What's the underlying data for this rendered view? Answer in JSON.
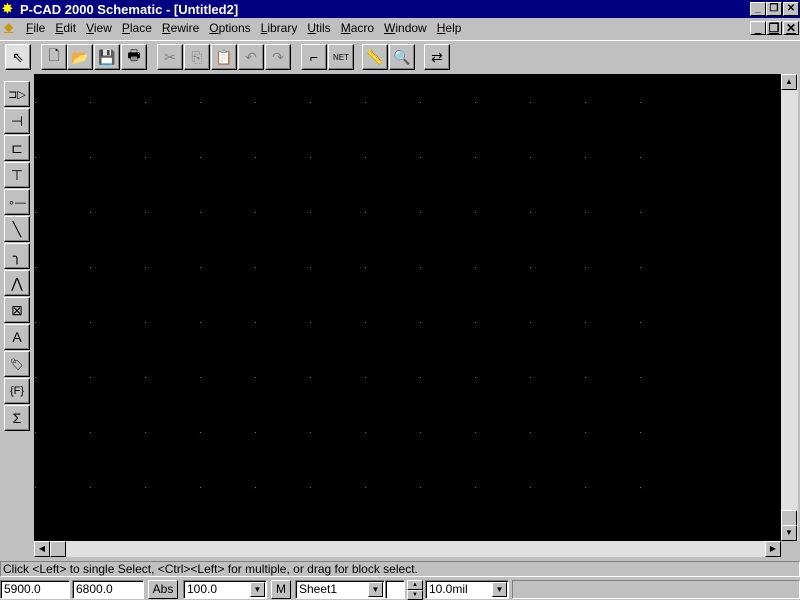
{
  "window": {
    "title": "P-CAD 2000 Schematic - [Untitled2]",
    "minimize": "_",
    "restore": "❐",
    "close": "✕"
  },
  "menu": [
    "File",
    "Edit",
    "View",
    "Place",
    "Rewire",
    "Options",
    "Library",
    "Utils",
    "Macro",
    "Window",
    "Help"
  ],
  "toolbar": [
    {
      "name": "select-icon",
      "glyph": "⇖"
    },
    {
      "name": "new-icon",
      "glyph": "🗋"
    },
    {
      "name": "open-icon",
      "glyph": "📂"
    },
    {
      "name": "save-icon",
      "glyph": "💾"
    },
    {
      "name": "print-icon",
      "glyph": "🖶"
    },
    {
      "name": "cut-icon",
      "glyph": "✂",
      "disabled": true
    },
    {
      "name": "copy-icon",
      "glyph": "⎘",
      "disabled": true
    },
    {
      "name": "paste-icon",
      "glyph": "📋",
      "disabled": true
    },
    {
      "name": "undo-icon",
      "glyph": "↶",
      "disabled": true
    },
    {
      "name": "redo-icon",
      "glyph": "↷",
      "disabled": true
    },
    {
      "name": "route-icon",
      "glyph": "⌐"
    },
    {
      "name": "net-rename-icon",
      "glyph": "NET"
    },
    {
      "name": "measure-icon",
      "glyph": "📏"
    },
    {
      "name": "zoom-icon",
      "glyph": "🔍"
    },
    {
      "name": "swap-icon",
      "glyph": "⇄"
    }
  ],
  "side_tools": [
    {
      "name": "place-part-icon",
      "glyph": "⊐▷"
    },
    {
      "name": "place-wire-icon",
      "glyph": "⊣"
    },
    {
      "name": "place-bus-icon",
      "glyph": "⊏"
    },
    {
      "name": "place-port-icon",
      "glyph": "⊤"
    },
    {
      "name": "place-pin-icon",
      "glyph": "∘—"
    },
    {
      "name": "place-line-icon",
      "glyph": "╲"
    },
    {
      "name": "place-arc-icon",
      "glyph": "╮"
    },
    {
      "name": "place-polygon-icon",
      "glyph": "⋀"
    },
    {
      "name": "place-field-box-icon",
      "glyph": "⊠"
    },
    {
      "name": "place-text-icon",
      "glyph": "A"
    },
    {
      "name": "place-attribute-icon",
      "glyph": "🏷"
    },
    {
      "name": "place-field-icon",
      "glyph": "{F}"
    },
    {
      "name": "place-ieee-icon",
      "glyph": "Σ"
    }
  ],
  "status": {
    "message": "Click <Left> to single Select, <Ctrl><Left> for multiple, or drag for block select.",
    "x": "5900.0",
    "y": "6800.0",
    "abs_label": "Abs",
    "zoom": "100.0",
    "m_label": "M",
    "sheet": "Sheet1",
    "grid": "10.0mil"
  },
  "colors": {
    "canvas": "#000000",
    "grid": "#00c000",
    "titlebar": "#000080"
  }
}
